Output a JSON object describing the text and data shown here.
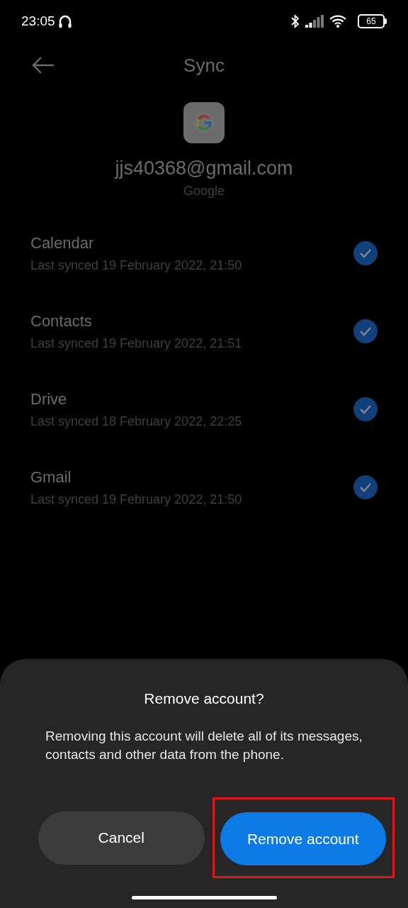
{
  "status_bar": {
    "time": "23:05",
    "battery": "65"
  },
  "header": {
    "title": "Sync"
  },
  "account": {
    "email": "jjs40368@gmail.com",
    "provider": "Google"
  },
  "sync_items": [
    {
      "name": "Calendar",
      "subtitle": "Last synced 19 February 2022, 21:50",
      "checked": true
    },
    {
      "name": "Contacts",
      "subtitle": "Last synced 19 February 2022, 21:51",
      "checked": true
    },
    {
      "name": "Drive",
      "subtitle": "Last synced 18 February 2022, 22:25",
      "checked": true
    },
    {
      "name": "Gmail",
      "subtitle": "Last synced 19 February 2022, 21:50",
      "checked": true
    }
  ],
  "dialog": {
    "title": "Remove account?",
    "message": "Removing this account will delete all of its messages, contacts and other data from the phone.",
    "buttons": [
      {
        "label": "Cancel",
        "kind": "secondary",
        "highlighted": false
      },
      {
        "label": "Remove account",
        "kind": "primary",
        "highlighted": true
      }
    ]
  }
}
